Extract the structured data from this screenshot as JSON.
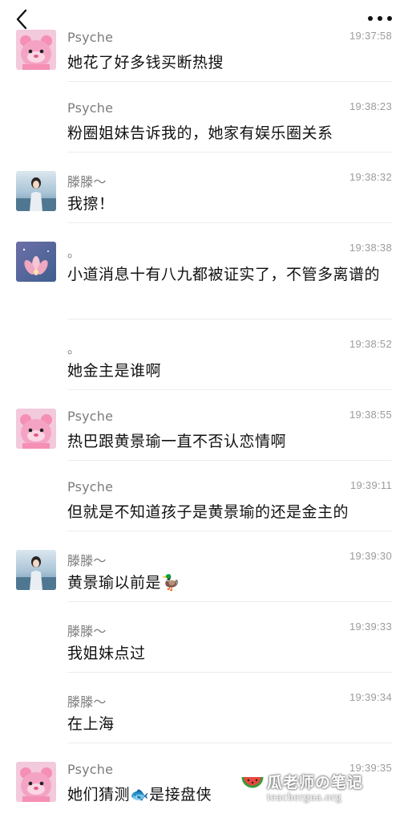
{
  "nav": {
    "back_icon": "chevron-left-icon",
    "more_icon": "more-dots-icon"
  },
  "messages": [
    {
      "sender": "Psyche",
      "time": "19:37:58",
      "text": "她花了好多钱买断热搜"
    },
    {
      "sender": "Psyche",
      "time": "19:38:23",
      "text": "粉圈姐妹告诉我的，她家有娱乐圈关系"
    },
    {
      "sender": "滕滕～",
      "time": "19:38:32",
      "text": "我擦！"
    },
    {
      "sender": "。",
      "time": "19:38:38",
      "text": "小道消息十有八九都被证实了，不管多离谱的"
    },
    {
      "sender": "。",
      "time": "19:38:52",
      "text": "她金主是谁啊"
    },
    {
      "sender": "Psyche",
      "time": "19:38:55",
      "text": "热巴跟黄景瑜一直不否认恋情啊"
    },
    {
      "sender": "Psyche",
      "time": "19:39:11",
      "text": "但就是不知道孩子是黄景瑜的还是金主的"
    },
    {
      "sender": "滕滕～",
      "time": "19:39:30",
      "text": "黄景瑜以前是🦆"
    },
    {
      "sender": "滕滕～",
      "time": "19:39:33",
      "text": "我姐妹点过"
    },
    {
      "sender": "滕滕～",
      "time": "19:39:34",
      "text": "在上海"
    },
    {
      "sender": "Psyche",
      "time": "19:39:35",
      "text": "她们猜测🐟是接盘侠"
    }
  ],
  "watermark": {
    "title": "瓜老师の笔记",
    "subtitle": "teachergua.org"
  }
}
